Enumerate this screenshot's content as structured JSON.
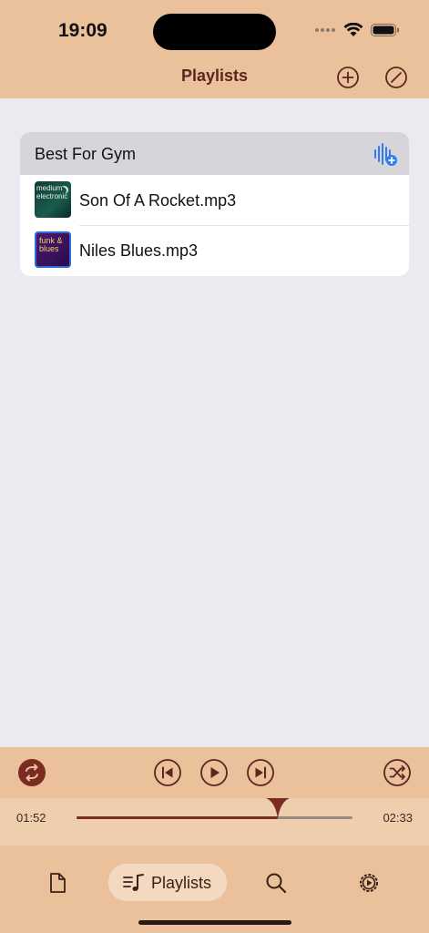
{
  "status": {
    "time": "19:09"
  },
  "nav": {
    "title": "Playlists"
  },
  "playlist": {
    "name": "Best For Gym",
    "tracks": [
      {
        "name": "Son Of A Rocket.mp3",
        "art_text": "medium electronic"
      },
      {
        "name": "Niles Blues.mp3",
        "art_text": "funk & blues"
      }
    ]
  },
  "player": {
    "elapsed": "01:52",
    "duration": "02:33",
    "progress": 0.73
  },
  "tabs": {
    "active_label": "Playlists"
  },
  "colors": {
    "accent": "#7a2b22",
    "bar": "#ebc19c",
    "blue": "#2f7cf6"
  }
}
